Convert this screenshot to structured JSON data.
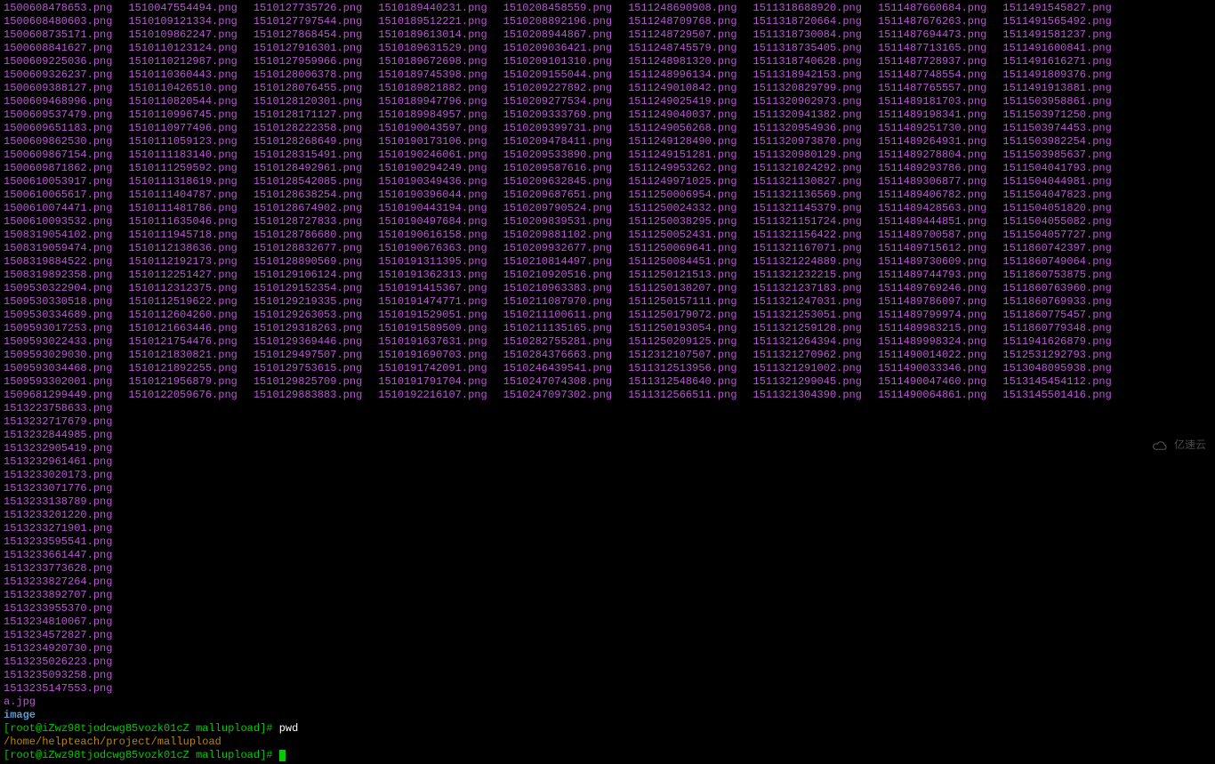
{
  "files": {
    "col0": [
      "1500608478653.png",
      "1500608480603.png",
      "1500608735171.png",
      "1500608841627.png",
      "1500609225036.png",
      "1500609326237.png",
      "1500609388127.png",
      "1500609468996.png",
      "1500609537479.png",
      "1500609651183.png",
      "1500609862530.png",
      "1500609867154.png",
      "1500609871862.png",
      "1500610053917.png",
      "1500610065617.png",
      "1500610074471.png",
      "1500610093532.png",
      "1508319054102.png",
      "1508319059474.png",
      "1508319884522.png",
      "1508319892358.png",
      "1509530322904.png",
      "1509530330518.png",
      "1509530334689.png",
      "1509593017253.png",
      "1509593022433.png",
      "1509593029030.png",
      "1509593034468.png",
      "1509593302001.png",
      "1509681299449.png"
    ],
    "col1": [
      "1510047554494.png",
      "1510109121334.png",
      "1510109862247.png",
      "1510110123124.png",
      "1510110212987.png",
      "1510110360443.png",
      "1510110426510.png",
      "1510110820544.png",
      "1510110996745.png",
      "1510110977496.png",
      "1510111059123.png",
      "1510111183140.png",
      "1510111259592.png",
      "1510111318619.png",
      "1510111404787.png",
      "1510111481786.png",
      "1510111635046.png",
      "1510111945718.png",
      "1510112138636.png",
      "1510112192173.png",
      "1510112251427.png",
      "1510112312375.png",
      "1510112519622.png",
      "1510112604260.png",
      "1510121663446.png",
      "1510121754476.png",
      "1510121830821.png",
      "1510121892255.png",
      "1510121956879.png",
      "1510122059676.png"
    ],
    "col2": [
      "1510127735726.png",
      "1510127797544.png",
      "1510127868454.png",
      "1510127916301.png",
      "1510127959966.png",
      "1510128006378.png",
      "1510128076455.png",
      "1510128120301.png",
      "1510128171127.png",
      "1510128222358.png",
      "1510128268649.png",
      "1510128315491.png",
      "1510128492961.png",
      "1510128542085.png",
      "1510128638254.png",
      "1510128674902.png",
      "1510128727833.png",
      "1510128786680.png",
      "1510128832677.png",
      "1510128890569.png",
      "1510129106124.png",
      "1510129152354.png",
      "1510129219335.png",
      "1510129263053.png",
      "1510129318263.png",
      "1510129369446.png",
      "1510129497507.png",
      "1510129753615.png",
      "1510129825709.png",
      "1510129883883.png"
    ],
    "col3": [
      "1510189440231.png",
      "1510189512221.png",
      "1510189613014.png",
      "1510189631529.png",
      "1510189672698.png",
      "1510189745398.png",
      "1510189821882.png",
      "1510189947796.png",
      "1510189984957.png",
      "1510190043597.png",
      "1510190173106.png",
      "1510190246061.png",
      "1510190294249.png",
      "1510190349436.png",
      "1510190396044.png",
      "1510190443194.png",
      "1510190497684.png",
      "1510190616158.png",
      "1510190676363.png",
      "1510191311395.png",
      "1510191362313.png",
      "1510191415367.png",
      "1510191474771.png",
      "1510191529051.png",
      "1510191589509.png",
      "1510191637631.png",
      "1510191690703.png",
      "1510191742091.png",
      "1510191791704.png",
      "1510192216107.png"
    ],
    "col4": [
      "1510208458559.png",
      "1510208892196.png",
      "1510208944867.png",
      "1510209036421.png",
      "1510209101310.png",
      "1510209155044.png",
      "1510209227892.png",
      "1510209277534.png",
      "1510209333769.png",
      "1510209399731.png",
      "1510209478411.png",
      "1510209533890.png",
      "1510209587616.png",
      "1510209632845.png",
      "1510209687651.png",
      "1510209790524.png",
      "1510209839531.png",
      "1510209881102.png",
      "1510209932677.png",
      "1510210814497.png",
      "1510210920516.png",
      "1510210963383.png",
      "1510211087970.png",
      "1510211100611.png",
      "1510211135165.png",
      "1510282755281.png",
      "1510284376663.png",
      "1510246439541.png",
      "1510247074308.png",
      "1510247097302.png"
    ],
    "col5": [
      "1511248690908.png",
      "1511248709768.png",
      "1511248729507.png",
      "1511248745579.png",
      "1511248981320.png",
      "1511248996134.png",
      "1511249010842.png",
      "1511249025419.png",
      "1511249040037.png",
      "1511249056268.png",
      "1511249128490.png",
      "1511249151281.png",
      "1511249953262.png",
      "1511249971025.png",
      "1511250006954.png",
      "1511250024332.png",
      "1511250038295.png",
      "1511250052431.png",
      "1511250069641.png",
      "1511250084451.png",
      "1511250121513.png",
      "1511250138207.png",
      "1511250157111.png",
      "1511250179072.png",
      "1511250193054.png",
      "1511250209125.png",
      "1512312107507.png",
      "1511312513956.png",
      "1511312548640.png",
      "1511312566511.png"
    ],
    "col6": [
      "1511318688920.png",
      "1511318720664.png",
      "1511318730084.png",
      "1511318735405.png",
      "1511318740628.png",
      "1511318942153.png",
      "1511320829799.png",
      "1511320902973.png",
      "1511320941382.png",
      "1511320954936.png",
      "1511320973870.png",
      "1511320980129.png",
      "1511321024292.png",
      "1511321130827.png",
      "1511321136569.png",
      "1511321145379.png",
      "1511321151724.png",
      "1511321156422.png",
      "1511321167071.png",
      "1511321224889.png",
      "1511321232215.png",
      "1511321237183.png",
      "1511321247031.png",
      "1511321253051.png",
      "1511321259128.png",
      "1511321264394.png",
      "1511321270962.png",
      "1511321291002.png",
      "1511321299045.png",
      "1511321304390.png"
    ],
    "col7": [
      "1511487660684.png",
      "1511487676263.png",
      "1511487694473.png",
      "1511487713165.png",
      "1511487728937.png",
      "1511487748554.png",
      "1511487765557.png",
      "1511489181703.png",
      "1511489198341.png",
      "1511489251730.png",
      "1511489264931.png",
      "1511489278804.png",
      "1511489293786.png",
      "1511489306877.png",
      "1511489406782.png",
      "1511489428563.png",
      "1511489444851.png",
      "1511489700587.png",
      "1511489715612.png",
      "1511489730609.png",
      "1511489744793.png",
      "1511489769246.png",
      "1511489786097.png",
      "1511489799974.png",
      "1511489983215.png",
      "1511489998324.png",
      "1511490014022.png",
      "1511490033346.png",
      "1511490047460.png",
      "1511490064861.png"
    ],
    "col8": [
      "1511491545827.png",
      "1511491565492.png",
      "1511491581237.png",
      "1511491600841.png",
      "1511491616271.png",
      "1511491809376.png",
      "1511491913881.png",
      "1511503958861.png",
      "1511503971250.png",
      "1511503974453.png",
      "1511503982254.png",
      "1511503985637.png",
      "1511504041793.png",
      "1511504044981.png",
      "1511504047823.png",
      "1511504051820.png",
      "1511504055082.png",
      "1511504057727.png",
      "1511860742397.png",
      "1511860749064.png",
      "1511860753875.png",
      "1511860763960.png",
      "1511860769933.png",
      "1511860775457.png",
      "1511860779348.png",
      "1511941626879.png",
      "1512531292793.png",
      "1513048095938.png",
      "1513145454112.png",
      "1513145501416.png"
    ],
    "col9": [
      "1513223758633.png",
      "1513232717679.png",
      "1513232844985.png",
      "1513232905419.png",
      "1513232961461.png",
      "1513233020173.png",
      "1513233071776.png",
      "1513233138789.png",
      "1513233201220.png",
      "1513233271901.png",
      "1513233595541.png",
      "1513233661447.png",
      "1513233773628.png",
      "1513233827264.png",
      "1513233892707.png",
      "1513233955370.png",
      "1513234810067.png",
      "1513234572827.png",
      "1513234920730.png",
      "1513235026223.png",
      "1513235093258.png",
      "1513235147553.png"
    ],
    "extras": [
      {
        "name": "a.jpg",
        "class": "file-jpg"
      },
      {
        "name": "image",
        "class": "file-dir"
      }
    ]
  },
  "prompt": {
    "user": "root",
    "host": "iZwz98tjodcwg85vozk01cZ",
    "loc": "mallupload",
    "cmd1": "pwd",
    "pwd_output": "/home/helpteach/project/mallupload",
    "cmd2": ""
  },
  "watermark": "亿速云"
}
